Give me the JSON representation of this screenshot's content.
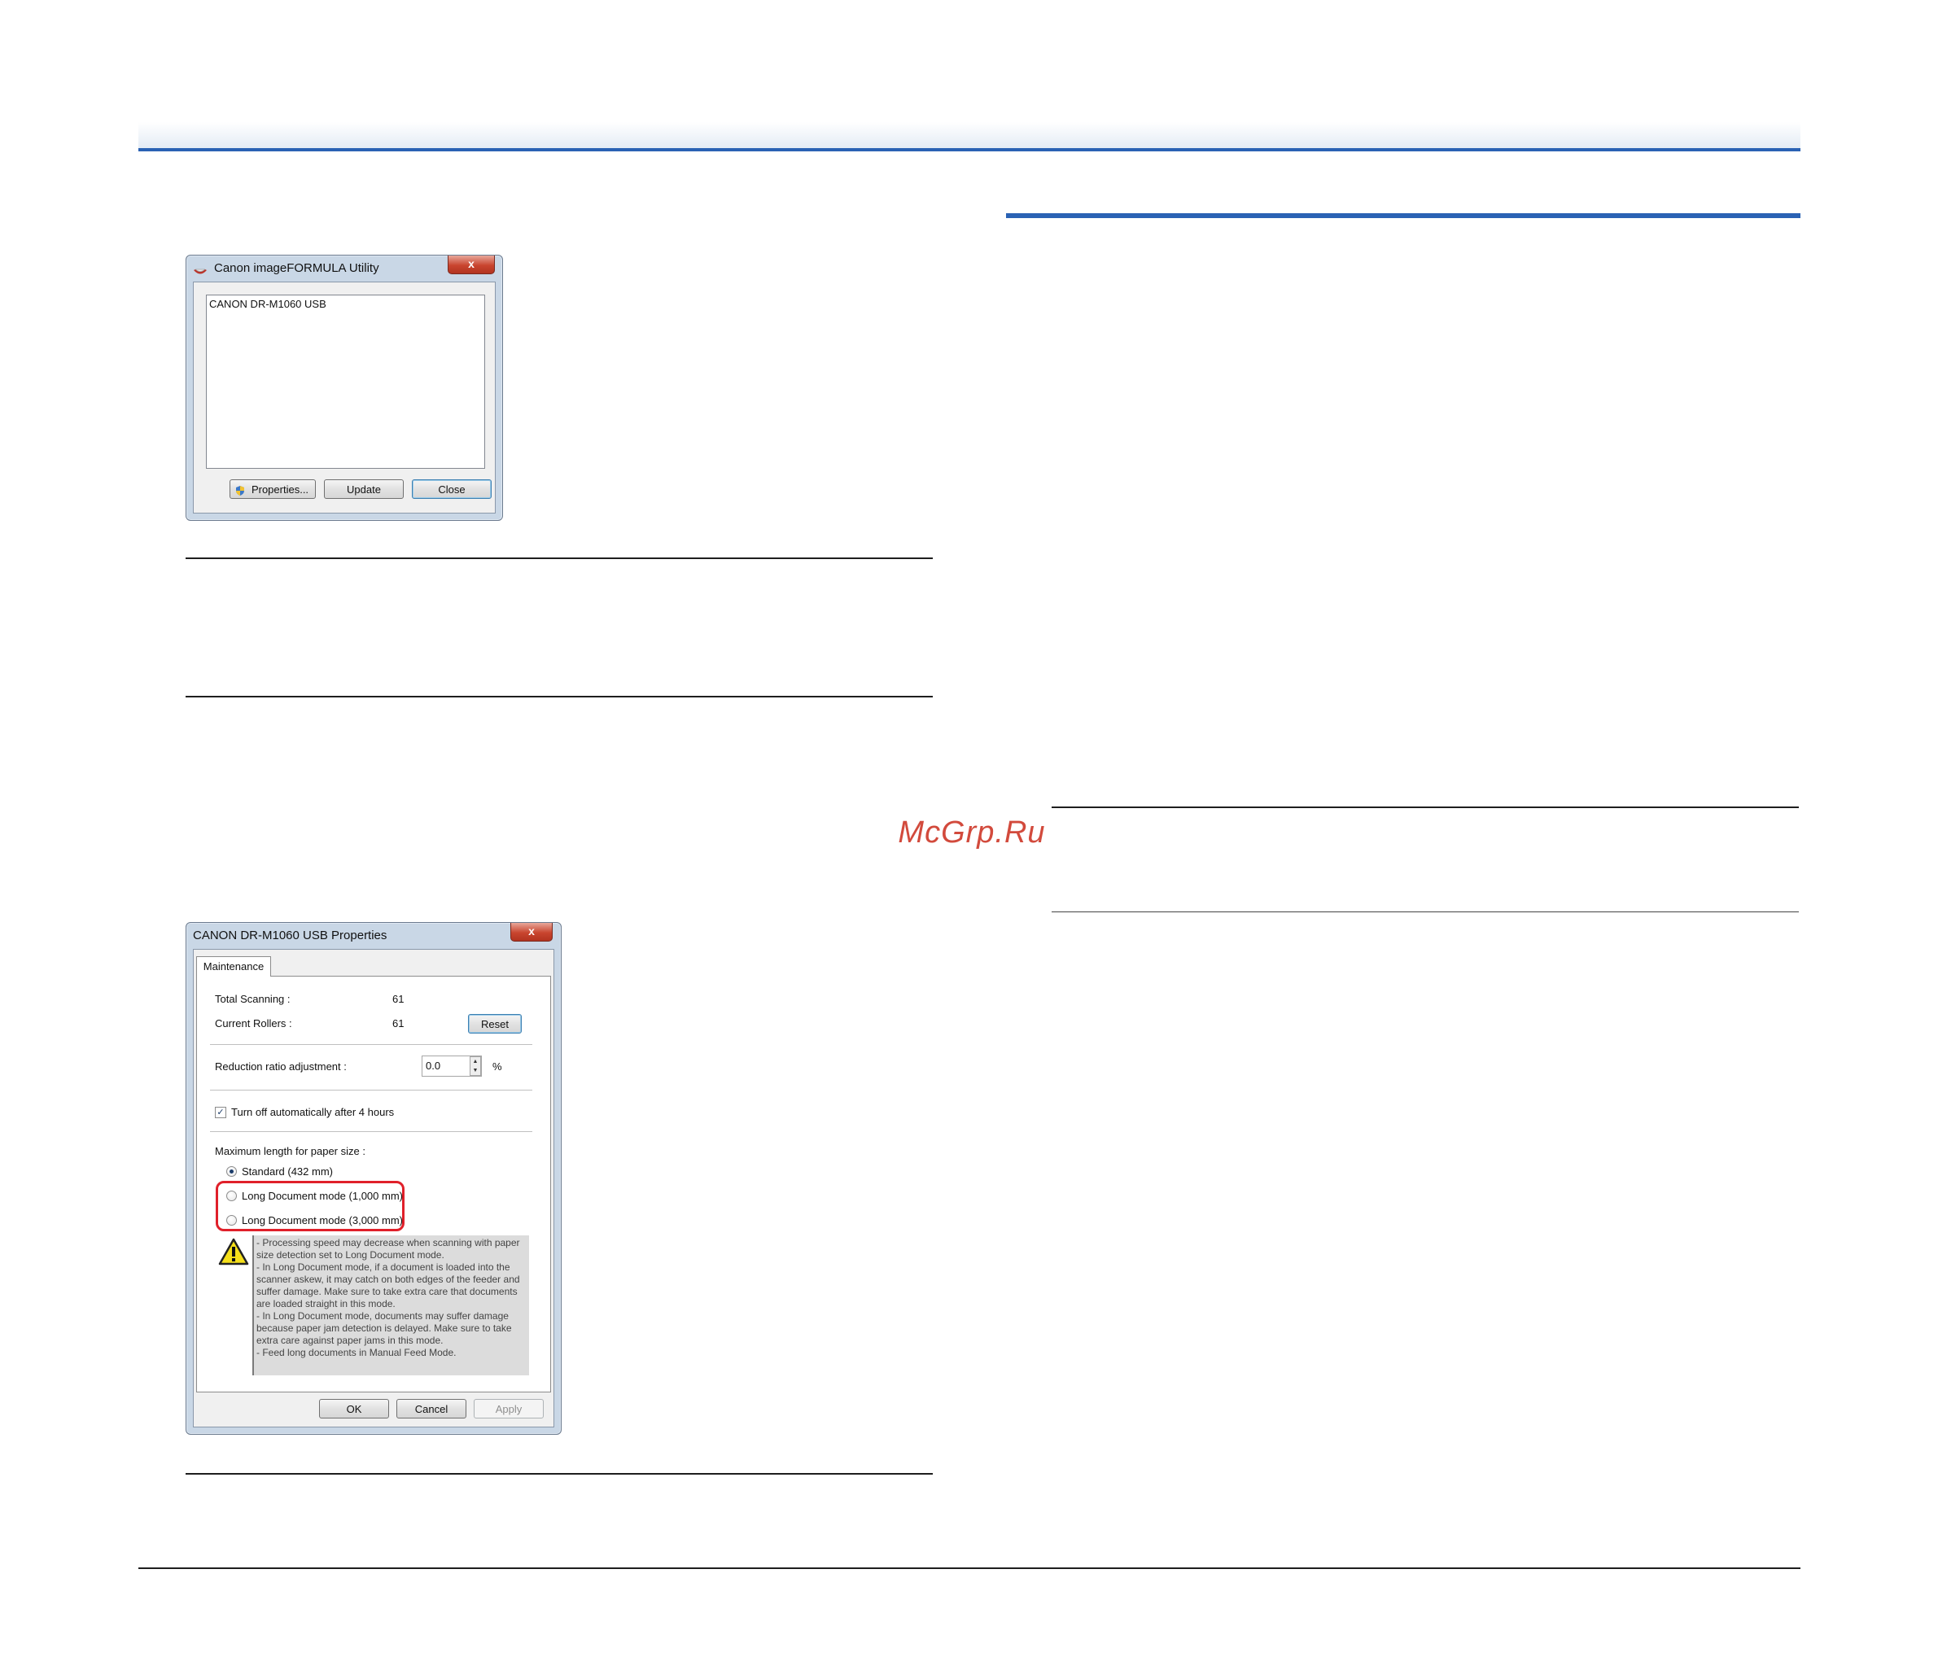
{
  "watermark": "McGrp.Ru",
  "utility_dialog": {
    "title": "Canon imageFORMULA Utility",
    "close_glyph": "x",
    "device_list": [
      "CANON DR-M1060 USB"
    ],
    "buttons": {
      "properties": "Properties...",
      "update": "Update",
      "close": "Close"
    }
  },
  "properties_dialog": {
    "title": "CANON DR-M1060 USB Properties",
    "close_glyph": "x",
    "tab": "Maintenance",
    "total_scanning_label": "Total Scanning :",
    "total_scanning_value": "61",
    "current_rollers_label": "Current Rollers :",
    "current_rollers_value": "61",
    "reset_button": "Reset",
    "reduction_label": "Reduction ratio adjustment :",
    "reduction_value": "0.0",
    "reduction_unit": "%",
    "auto_off_label": "Turn off automatically after 4 hours",
    "auto_off_checked": true,
    "max_length_label": "Maximum length for paper size :",
    "paper_options": [
      {
        "label": "Standard (432 mm)",
        "selected": true
      },
      {
        "label": "Long Document mode (1,000 mm)",
        "selected": false
      },
      {
        "label": "Long Document mode (3,000 mm)",
        "selected": false
      }
    ],
    "warning_text": "- Processing speed may decrease when scanning with paper size detection set to Long Document mode.\n- In Long Document mode, if a document is loaded into the scanner askew, it may catch on both edges of the feeder and suffer damage. Make sure to take extra care that documents are loaded straight in this mode.\n- In Long Document mode, documents may suffer damage because paper jam detection is delayed. Make sure to take extra care against paper jams in this mode.\n- Feed long documents in Manual Feed Mode.",
    "buttons": {
      "ok": "OK",
      "cancel": "Cancel",
      "apply": "Apply"
    }
  },
  "colors": {
    "accent_blue": "#2a62b4",
    "highlight_red": "#e0202a",
    "watermark": "#d24a3c"
  }
}
